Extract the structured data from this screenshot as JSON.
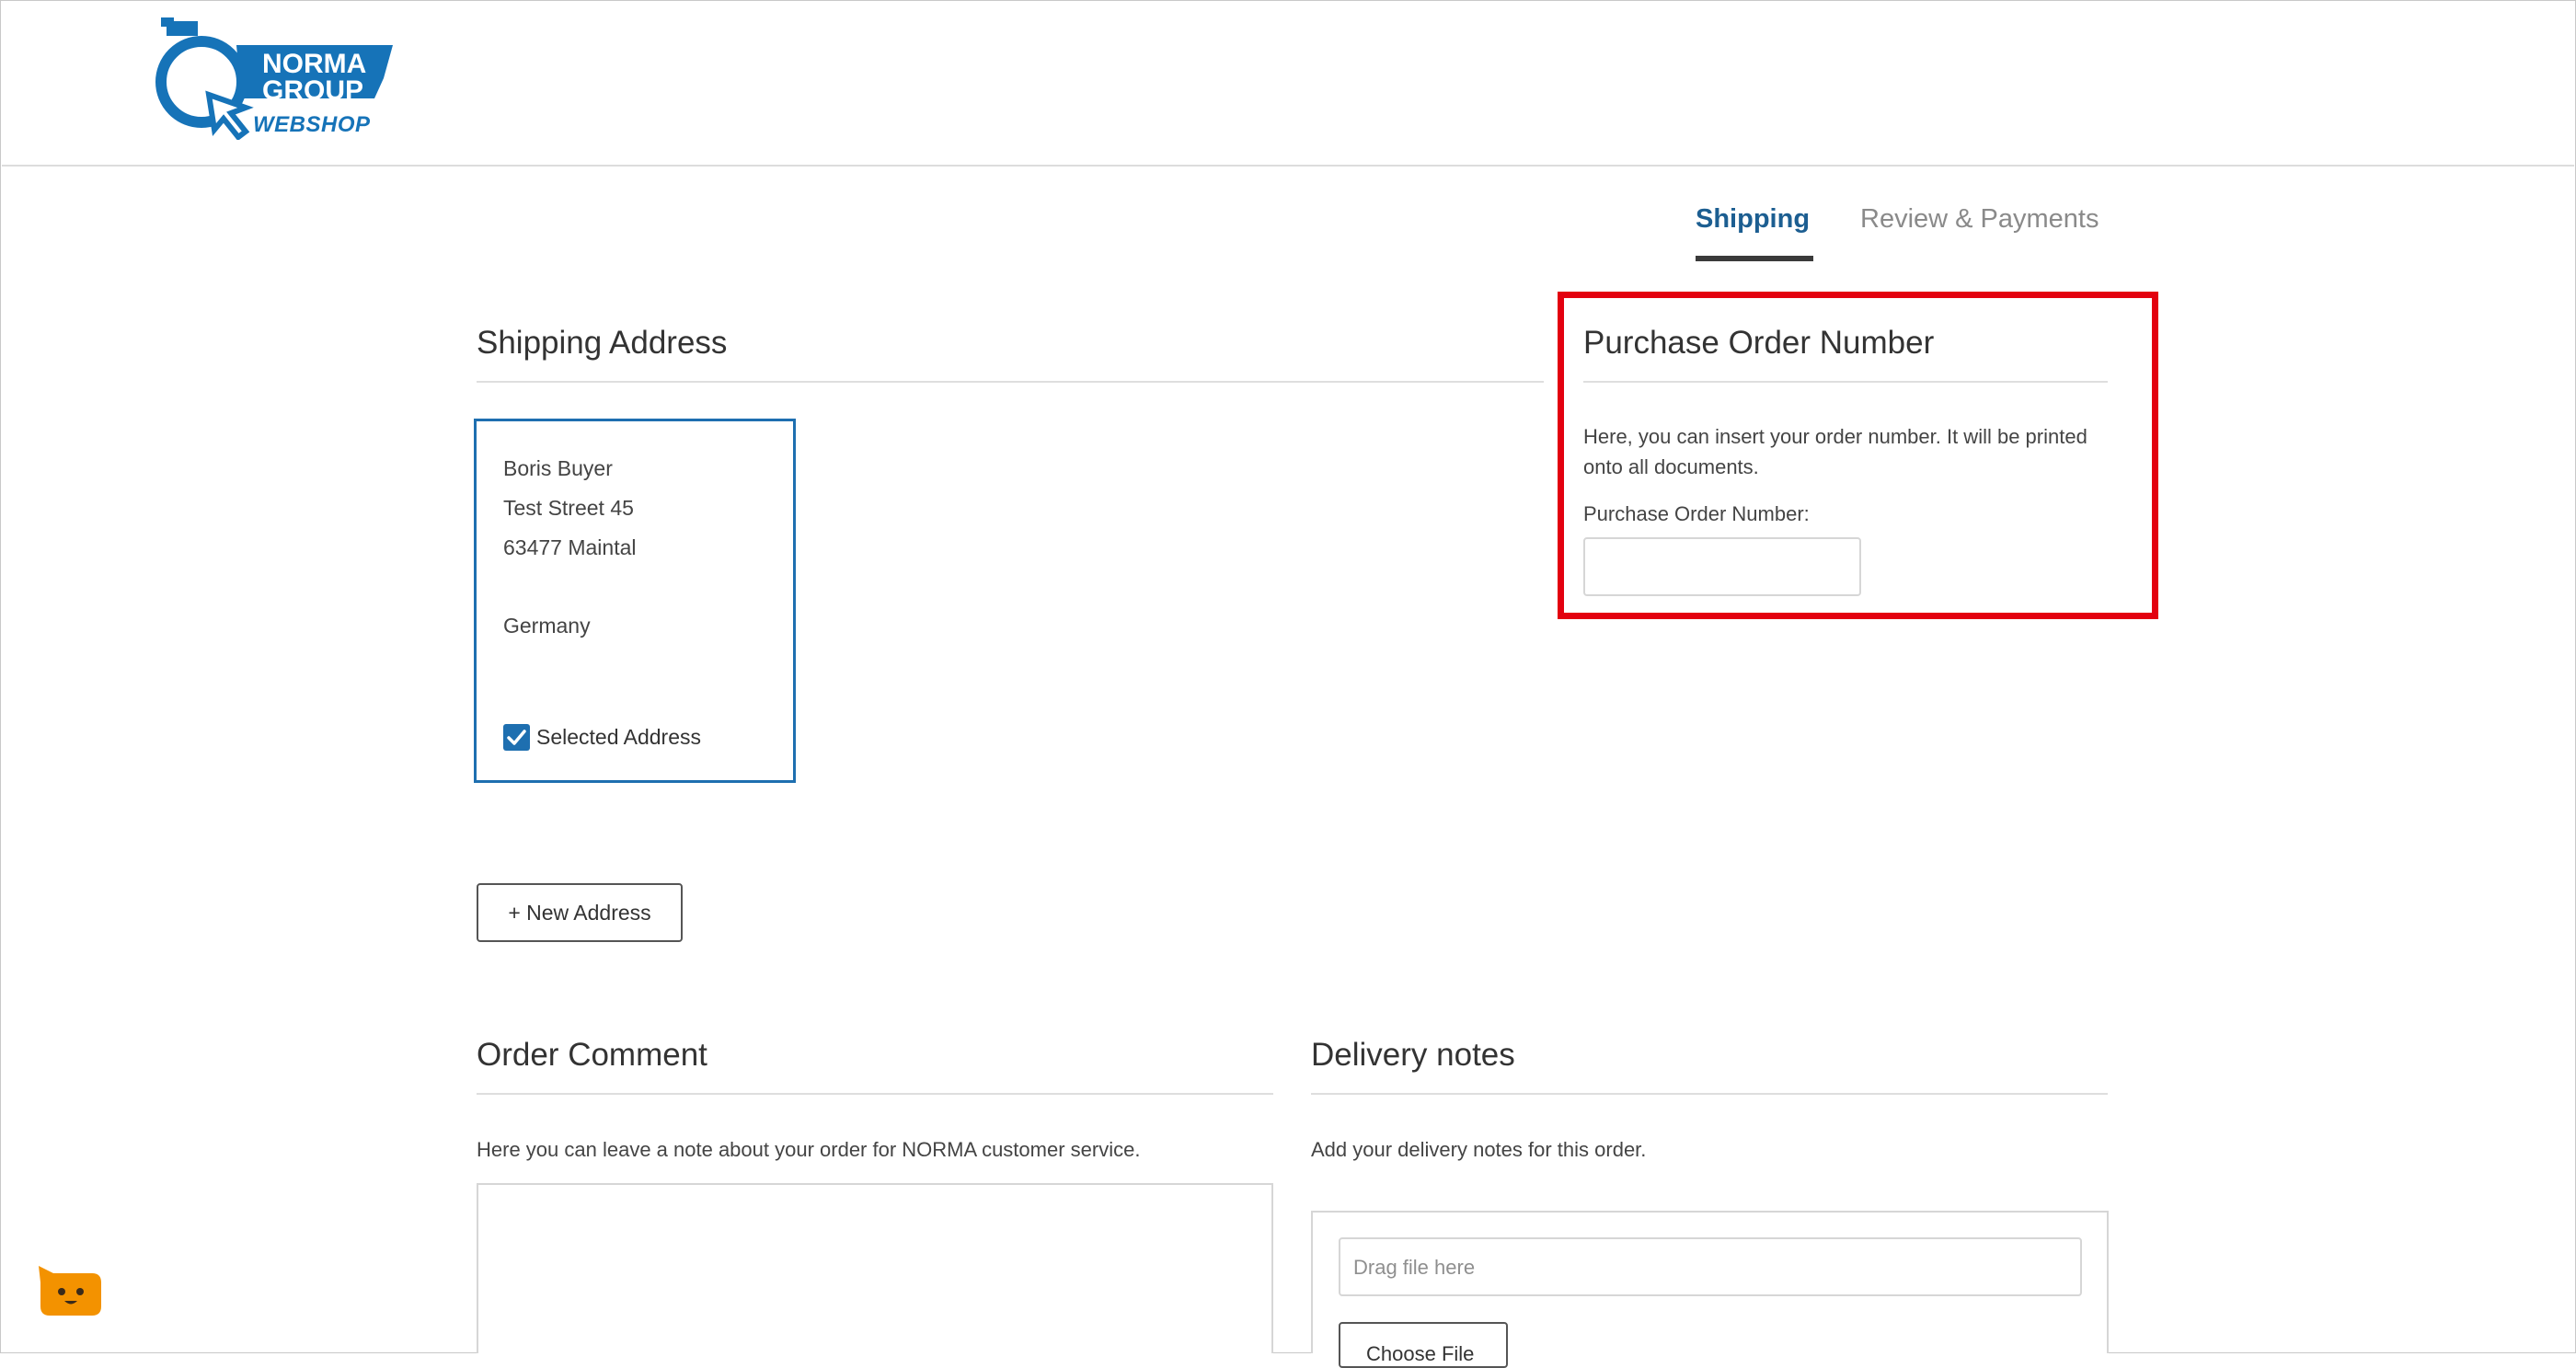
{
  "logo": {
    "line1": "NORMA",
    "line2": "GROUP",
    "line3": "WEBSHOP"
  },
  "tabs": [
    {
      "label": "Shipping",
      "active": true
    },
    {
      "label": "Review & Payments",
      "active": false
    }
  ],
  "shipping_address": {
    "title": "Shipping Address",
    "card": {
      "name": "Boris Buyer",
      "street": "Test Street 45",
      "city": "63477 Maintal",
      "country": "Germany",
      "selected_label": "Selected Address",
      "selected": true
    },
    "new_address_label": "+ New Address"
  },
  "purchase_order": {
    "title": "Purchase Order Number",
    "help": "Here, you can insert your order number. It will be printed onto all documents.",
    "field_label": "Purchase Order Number:",
    "value": ""
  },
  "order_comment": {
    "title": "Order Comment",
    "help": "Here you can leave a note about your order for NORMA customer service.",
    "value": ""
  },
  "delivery_notes": {
    "title": "Delivery notes",
    "help": "Add your delivery notes for this order.",
    "drag_placeholder": "Drag file here",
    "choose_file_label": "Choose File"
  },
  "colors": {
    "brand_blue": "#1673b8",
    "active_tab": "#1c5e91",
    "highlight_red": "#e3000f",
    "chat_orange": "#f39200"
  }
}
